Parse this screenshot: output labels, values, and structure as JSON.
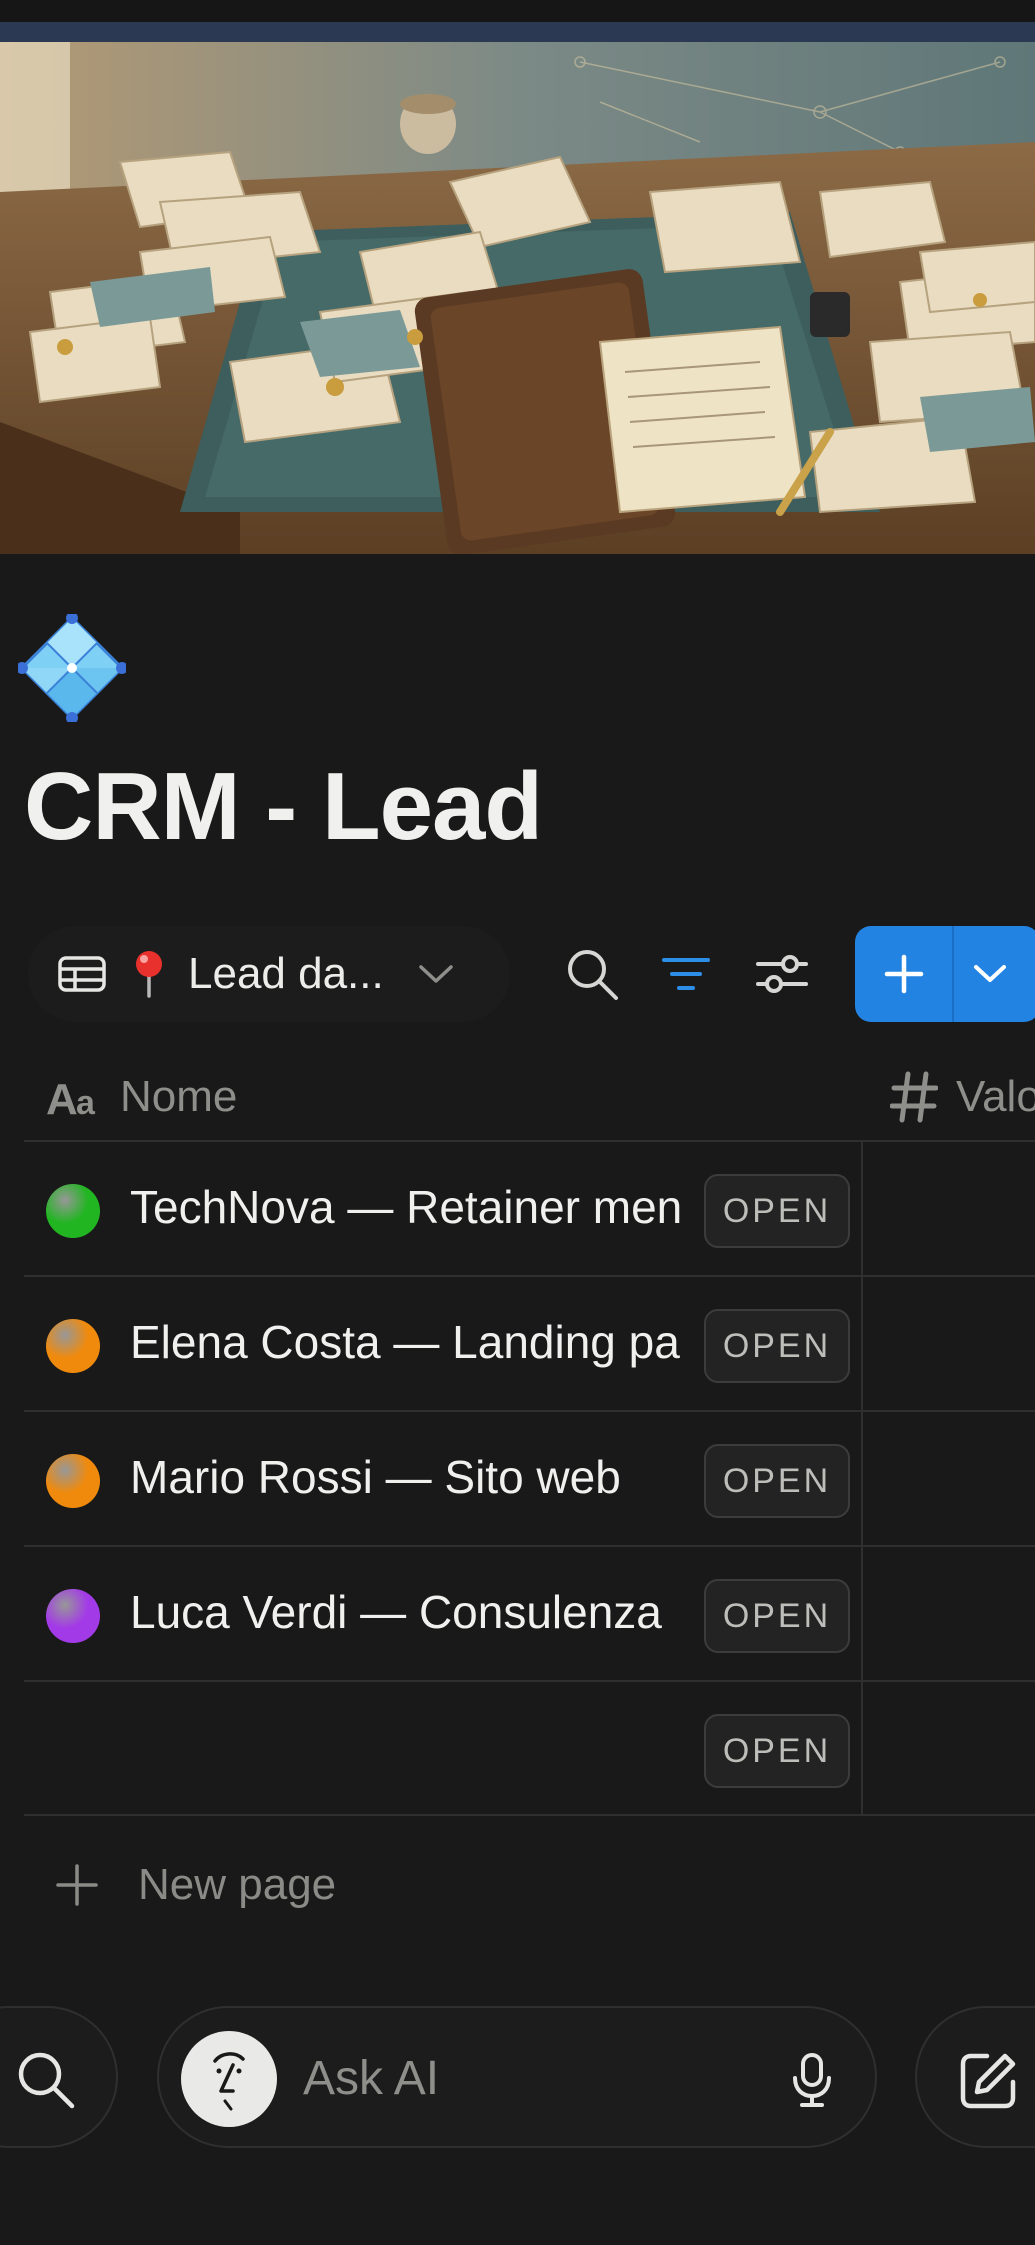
{
  "page": {
    "title": "CRM - Lead",
    "cover_description": "illustrated cover image",
    "icon": "crystal-diamond-icon"
  },
  "toolbar": {
    "view_label": "Lead da...",
    "view_icon": "table-icon",
    "view_emoji": "pin-icon",
    "search_icon": "search-icon",
    "filter_icon": "filter-icon",
    "settings_icon": "sliders-icon",
    "new_button_icon": "plus-icon",
    "new_button_menu_icon": "chevron-down-icon",
    "accent_color": "#2383e2"
  },
  "table": {
    "columns": [
      {
        "label": "Nome",
        "icon": "text-property-icon"
      },
      {
        "label": "Valo",
        "icon": "number-property-icon"
      }
    ],
    "rows": [
      {
        "name": "TechNova — Retainer men",
        "status_color": "#22b522",
        "open_label": "OPEN"
      },
      {
        "name": "Elena Costa — Landing pa",
        "status_color": "#f08a0c",
        "open_label": "OPEN"
      },
      {
        "name": "Mario Rossi — Sito web",
        "status_color": "#f08a0c",
        "open_label": "OPEN"
      },
      {
        "name": "Luca Verdi — Consulenza",
        "status_color": "#a33ae8",
        "open_label": "OPEN"
      },
      {
        "name": "",
        "status_color": "",
        "open_label": "OPEN"
      }
    ],
    "new_page_label": "New page"
  },
  "bottom_bar": {
    "search_icon": "search-icon",
    "ask_ai_label": "Ask AI",
    "ai_avatar_icon": "notion-ai-face-icon",
    "mic_icon": "microphone-icon",
    "compose_icon": "compose-icon"
  }
}
